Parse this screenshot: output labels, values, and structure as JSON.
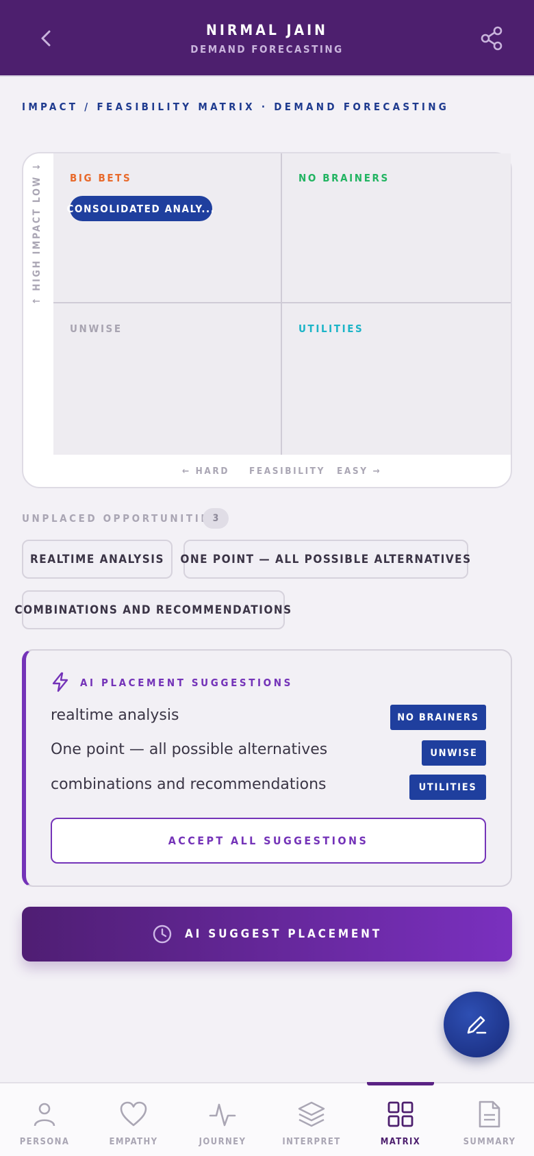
{
  "header": {
    "title": "NIRMAL JAIN",
    "subtitle": "DEMAND FORECASTING",
    "back_icon": "chevron-left-icon",
    "share_icon": "share-icon"
  },
  "section_title": "IMPACT / FEASIBILITY MATRIX · DEMAND FORECASTING",
  "matrix": {
    "y_axis_label": "↑ HIGH IMPACT LOW ↓",
    "x_axis": {
      "left": "← HARD",
      "center": "FEASIBILITY",
      "right": "EASY →"
    },
    "quadrants": {
      "big_bets": "BIG BETS",
      "no_brainers": "NO BRAINERS",
      "unwise": "UNWISE",
      "utilities": "UTILITIES"
    },
    "placed": [
      {
        "label": "CONSOLIDATED ANALY...",
        "quadrant": "big_bets"
      }
    ]
  },
  "unplaced": {
    "label": "UNPLACED OPPORTUNITIES",
    "count": "3",
    "items": [
      "REALTIME ANALYSIS",
      "ONE POINT — ALL POSSIBLE ALTERNATIVES",
      "COMBINATIONS AND RECOMMENDATIONS"
    ]
  },
  "ai_suggestions": {
    "title": "AI PLACEMENT SUGGESTIONS",
    "icon": "lightning-icon",
    "items": [
      {
        "text": "realtime analysis",
        "tag": "NO BRAINERS"
      },
      {
        "text": "One point — all possible alternatives",
        "tag": "UNWISE"
      },
      {
        "text": "combinations and recommendations",
        "tag": "UTILITIES"
      }
    ],
    "accept_label": "ACCEPT ALL SUGGESTIONS"
  },
  "suggest_button": {
    "label": "AI SUGGEST PLACEMENT",
    "icon": "clock-icon"
  },
  "fab": {
    "icon": "pencil-icon"
  },
  "nav": {
    "items": [
      {
        "label": "PERSONA",
        "icon": "person-icon"
      },
      {
        "label": "EMPATHY",
        "icon": "heart-icon"
      },
      {
        "label": "JOURNEY",
        "icon": "pulse-icon"
      },
      {
        "label": "INTERPRET",
        "icon": "layers-icon"
      },
      {
        "label": "MATRIX",
        "icon": "grid-icon"
      },
      {
        "label": "SUMMARY",
        "icon": "document-icon"
      }
    ],
    "active": "MATRIX"
  },
  "colors": {
    "header_bg": "#4d1f6e",
    "accent_purple": "#7433b8",
    "tag_blue": "#1f3f9e",
    "big_bets": "#e86a2c",
    "no_brainers": "#22b462",
    "utilities": "#1bb4c7"
  }
}
